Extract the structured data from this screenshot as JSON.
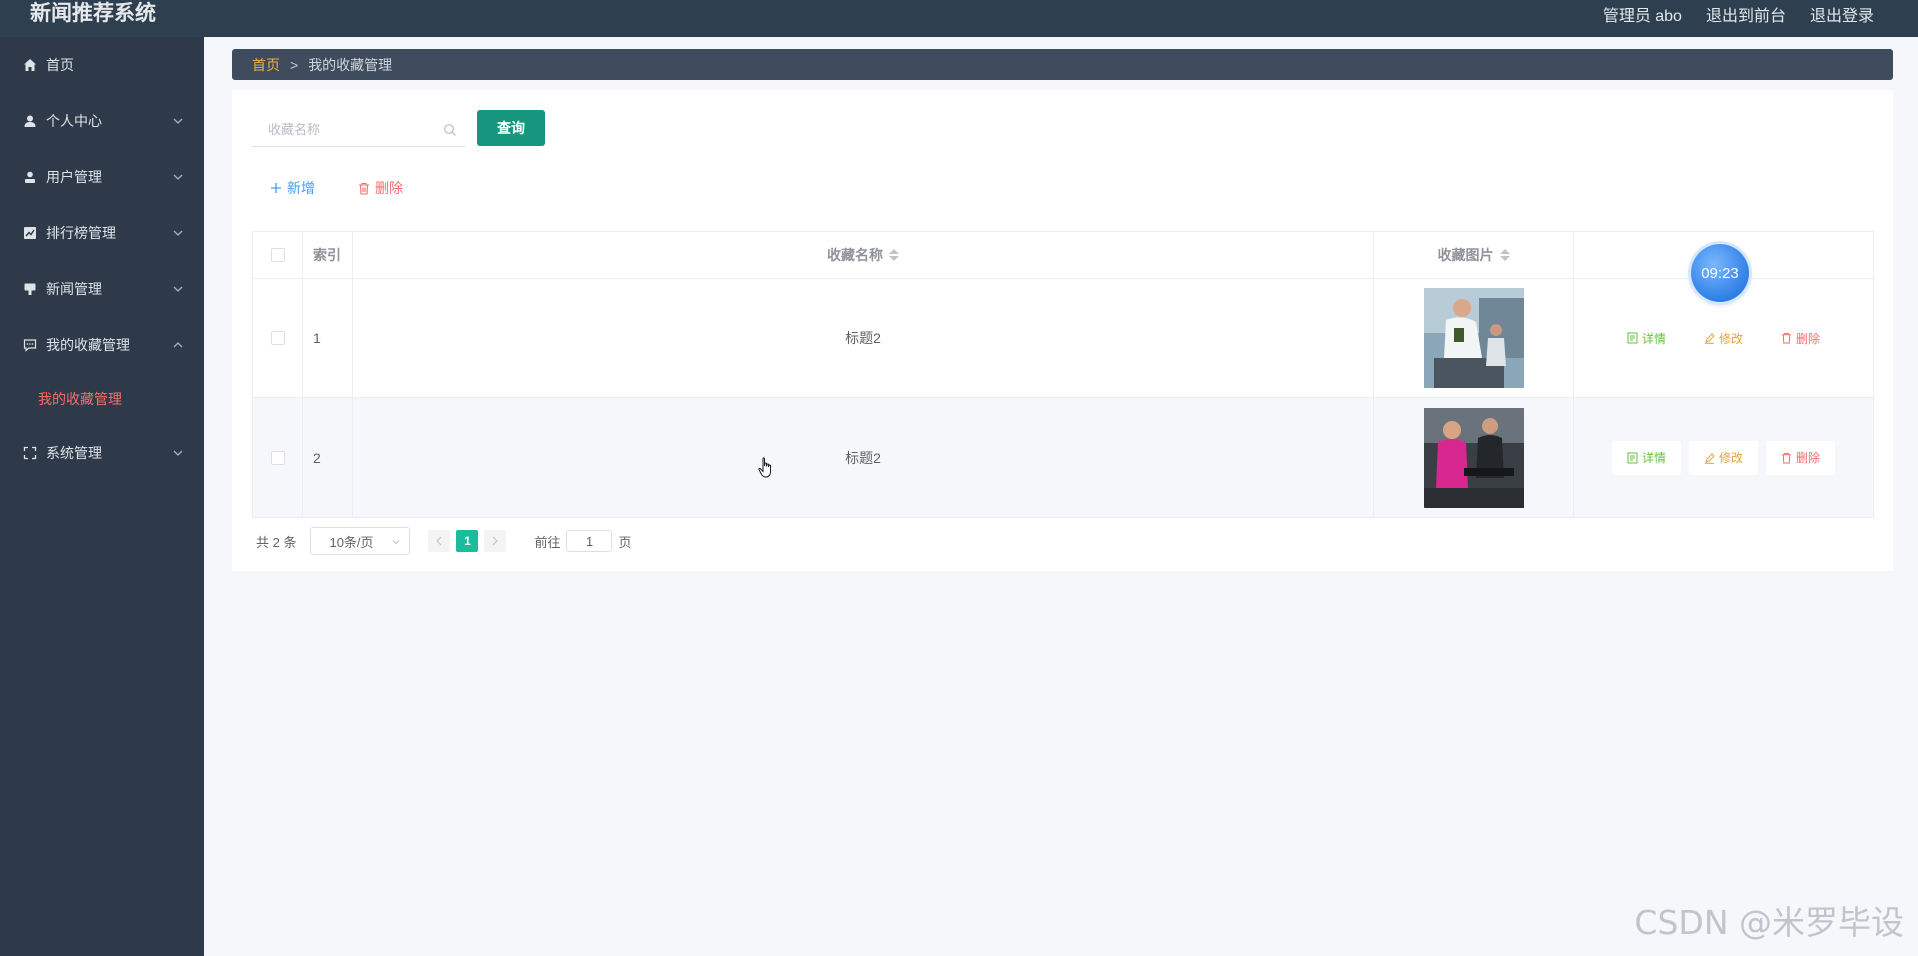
{
  "header": {
    "app_title": "新闻推荐系统",
    "user_label": "管理员 abo",
    "front_link": "退出到前台",
    "logout_link": "退出登录"
  },
  "sidebar": {
    "items": [
      {
        "label": "首页",
        "icon": "home-icon"
      },
      {
        "label": "个人中心",
        "icon": "user-icon"
      },
      {
        "label": "用户管理",
        "icon": "user-manage-icon"
      },
      {
        "label": "排行榜管理",
        "icon": "chart-icon"
      },
      {
        "label": "新闻管理",
        "icon": "news-icon"
      },
      {
        "label": "我的收藏管理",
        "icon": "chat-icon"
      },
      {
        "label": "系统管理",
        "icon": "fullscreen-icon"
      }
    ],
    "sub_item": "我的收藏管理"
  },
  "breadcrumb": {
    "home": "首页",
    "separator": ">",
    "current": "我的收藏管理"
  },
  "search": {
    "placeholder": "收藏名称",
    "button": "查询"
  },
  "actions": {
    "add": "新增",
    "delete": "删除"
  },
  "table": {
    "headers": {
      "index": "索引",
      "name": "收藏名称",
      "image": "收藏图片"
    },
    "rows": [
      {
        "index": "1",
        "name": "标题2"
      },
      {
        "index": "2",
        "name": "标题2"
      }
    ],
    "ops": {
      "detail": "详情",
      "edit": "修改",
      "delete": "删除"
    }
  },
  "pagination": {
    "total": "共 2 条",
    "page_size": "10条/页",
    "current_page": "1",
    "goto_label": "前往",
    "goto_value": "1",
    "page_suffix": "页"
  },
  "clock": "09:23",
  "watermark": "CSDN @米罗毕设",
  "colors": {
    "header_bg": "#2e3f50",
    "sidebar_bg": "#2e3a4a",
    "primary": "#16957f",
    "active_menu": "#f56c6c"
  }
}
